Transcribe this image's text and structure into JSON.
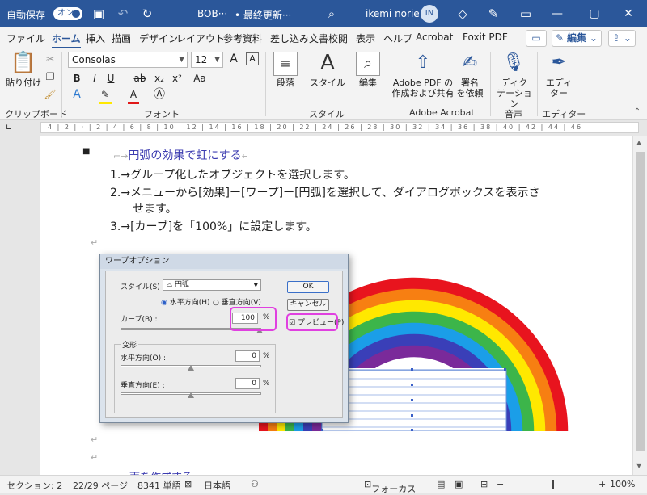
{
  "titlebar": {
    "autosave_label": "自動保存",
    "autosave_state": "オン",
    "doc_title": "BOB···",
    "save_state": "• 最終更新···",
    "user_name": "ikemi norie",
    "user_initials": "IN"
  },
  "tabs": [
    "ファイル",
    "ホーム",
    "挿入",
    "描画",
    "デザイン",
    "レイアウト",
    "参考資料",
    "差し込み文書",
    "校閲",
    "表示",
    "ヘルプ",
    "Acrobat",
    "Foxit PDF"
  ],
  "active_tab": "ホーム",
  "edit_button": "編集",
  "ribbon": {
    "clipboard": {
      "paste": "貼り付け",
      "label": "クリップボード"
    },
    "font": {
      "name": "Consolas",
      "size": "12",
      "label": "フォント",
      "buttons": [
        "B",
        "I",
        "U",
        "ab",
        "x₂",
        "x²",
        "A"
      ],
      "case_btn": "Aa",
      "grow": "A",
      "shrink": "A"
    },
    "paragraph": {
      "label": "段落"
    },
    "style": {
      "label": "スタイル",
      "group": "スタイル"
    },
    "edit": {
      "label": "編集"
    },
    "acrobat": {
      "create": "Adobe PDF の\n作成および共有",
      "sign": "署名\nを依頼",
      "group": "Adobe Acrobat"
    },
    "voice": {
      "dictate": "ディク\nテーション",
      "group": "音声"
    },
    "editor": {
      "label": "エディ\nター",
      "group": "エディター"
    }
  },
  "ruler_ticks": "4  |  2  |  ·  |  2  |  4  |  6  |  8  |  10  |  12  |  14  |  16  |  18  |  20  |  22  |  24  |  26  |  28  |  30  |  32  |  34  |  36  |  38  |  40  |  42  |  44  |  46",
  "document": {
    "heading": "円弧の効果で虹にする",
    "steps": [
      "1.→グループ化したオブジェクトを選択します。",
      "2.→メニューから[効果]ー[ワープ]ー[円弧]を選択して、ダイアログボックスを表示さ",
      "せます。",
      "3.→[カーブ]を「100%」に設定します。"
    ],
    "para_mark": "↵",
    "bottom_heading": "雨を作成する"
  },
  "dialog": {
    "title": "ワープオプション",
    "style_label": "スタイル(S) :",
    "style_value": "円弧",
    "horizontal": "水平方向(H)",
    "vertical": "垂直方向(V)",
    "curve_label": "カーブ(B) :",
    "curve_value": "100",
    "percent": "%",
    "distortion": "変形",
    "h_label": "水平方向(O) :",
    "h_value": "0",
    "v_label": "垂直方向(E) :",
    "v_value": "0",
    "ok": "OK",
    "cancel": "キャンセル",
    "preview": "プレビュー(P)"
  },
  "rainbow_colors": [
    "#e8141e",
    "#f77f12",
    "#ffe800",
    "#3cb54a",
    "#1b9ee8",
    "#3a3fb8",
    "#7a2a9a"
  ],
  "status": {
    "section": "セクション: 2",
    "pages": "22/29 ページ",
    "words": "8341 単語",
    "language": "日本語",
    "focus": "フォーカス",
    "zoom": "100%"
  }
}
